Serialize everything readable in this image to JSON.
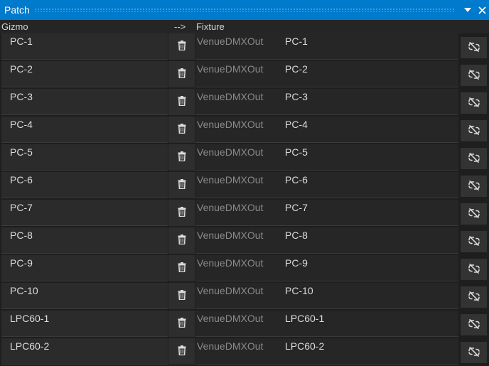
{
  "window": {
    "title": "Patch",
    "dropdown_icon": "chevron-down-icon",
    "close_icon": "close-icon"
  },
  "header": {
    "gizmo_label": "Gizmo",
    "arrow_label": "-->",
    "fixture_label": "Fixture"
  },
  "rows": [
    {
      "gizmo": "PC-1",
      "output": "VenueDMXOut",
      "fixture": "PC-1"
    },
    {
      "gizmo": "PC-2",
      "output": "VenueDMXOut",
      "fixture": "PC-2"
    },
    {
      "gizmo": "PC-3",
      "output": "VenueDMXOut",
      "fixture": "PC-3"
    },
    {
      "gizmo": "PC-4",
      "output": "VenueDMXOut",
      "fixture": "PC-4"
    },
    {
      "gizmo": "PC-5",
      "output": "VenueDMXOut",
      "fixture": "PC-5"
    },
    {
      "gizmo": "PC-6",
      "output": "VenueDMXOut",
      "fixture": "PC-6"
    },
    {
      "gizmo": "PC-7",
      "output": "VenueDMXOut",
      "fixture": "PC-7"
    },
    {
      "gizmo": "PC-8",
      "output": "VenueDMXOut",
      "fixture": "PC-8"
    },
    {
      "gizmo": "PC-9",
      "output": "VenueDMXOut",
      "fixture": "PC-9"
    },
    {
      "gizmo": "PC-10",
      "output": "VenueDMXOut",
      "fixture": "PC-10"
    },
    {
      "gizmo": "LPC60-1",
      "output": "VenueDMXOut",
      "fixture": "LPC60-1"
    },
    {
      "gizmo": "LPC60-2",
      "output": "VenueDMXOut",
      "fixture": "LPC60-2"
    }
  ],
  "icons": {
    "delete": "trash-icon",
    "unlink": "unlink-icon"
  },
  "colors": {
    "titlebar": "#007acc",
    "background": "#1e1e1e"
  }
}
